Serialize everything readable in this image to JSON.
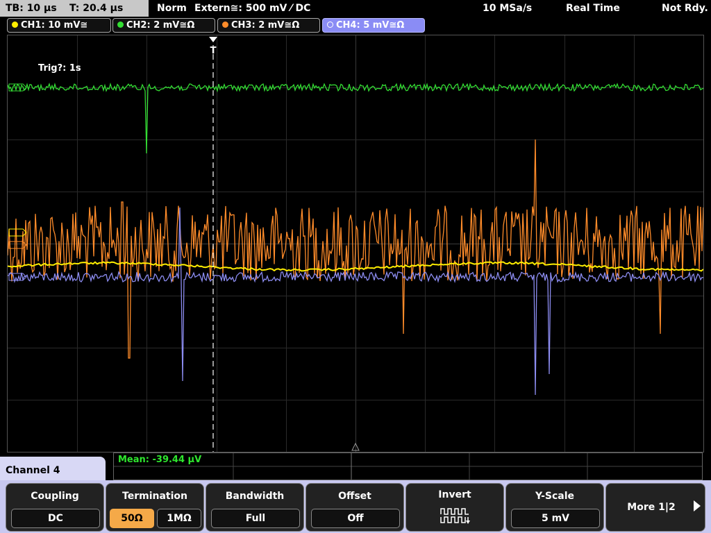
{
  "topbar": {
    "timebase": "TB: 10 µs",
    "trigger_time": "T: 20.4 µs",
    "mode": "Norm",
    "trigger_source": "Extern≅: 500 mV ⁄ DC",
    "sample_rate": "10 MSa/s",
    "acq_mode": "Real Time",
    "status": "Not Rdy."
  },
  "channels": [
    {
      "label": "CH1: 10 mV≅",
      "color": "#ffee00"
    },
    {
      "label": "CH2: 2 mV≅Ω",
      "color": "#33dd33"
    },
    {
      "label": "CH3: 2 mV≅Ω",
      "color": "#ff8c2a"
    },
    {
      "label": "CH4: 5 mV≅Ω",
      "color": "#8c8cf0"
    }
  ],
  "screen": {
    "trigger_status": "Trig?: 1s",
    "trigger_marker": "T"
  },
  "channel_menu": {
    "title": "Channel 4"
  },
  "measurement": {
    "mean": "Mean: -39.44 µV"
  },
  "softkeys": {
    "coupling": {
      "title": "Coupling",
      "value": "DC"
    },
    "termination": {
      "title": "Termination",
      "opt1": "50Ω",
      "opt2": "1MΩ"
    },
    "bandwidth": {
      "title": "Bandwidth",
      "value": "Full"
    },
    "offset": {
      "title": "Offset",
      "value": "Off"
    },
    "invert": {
      "title": "Invert"
    },
    "yscale": {
      "title": "Y-Scale",
      "value": "5 mV"
    },
    "more": {
      "label": "More 1|2"
    }
  }
}
